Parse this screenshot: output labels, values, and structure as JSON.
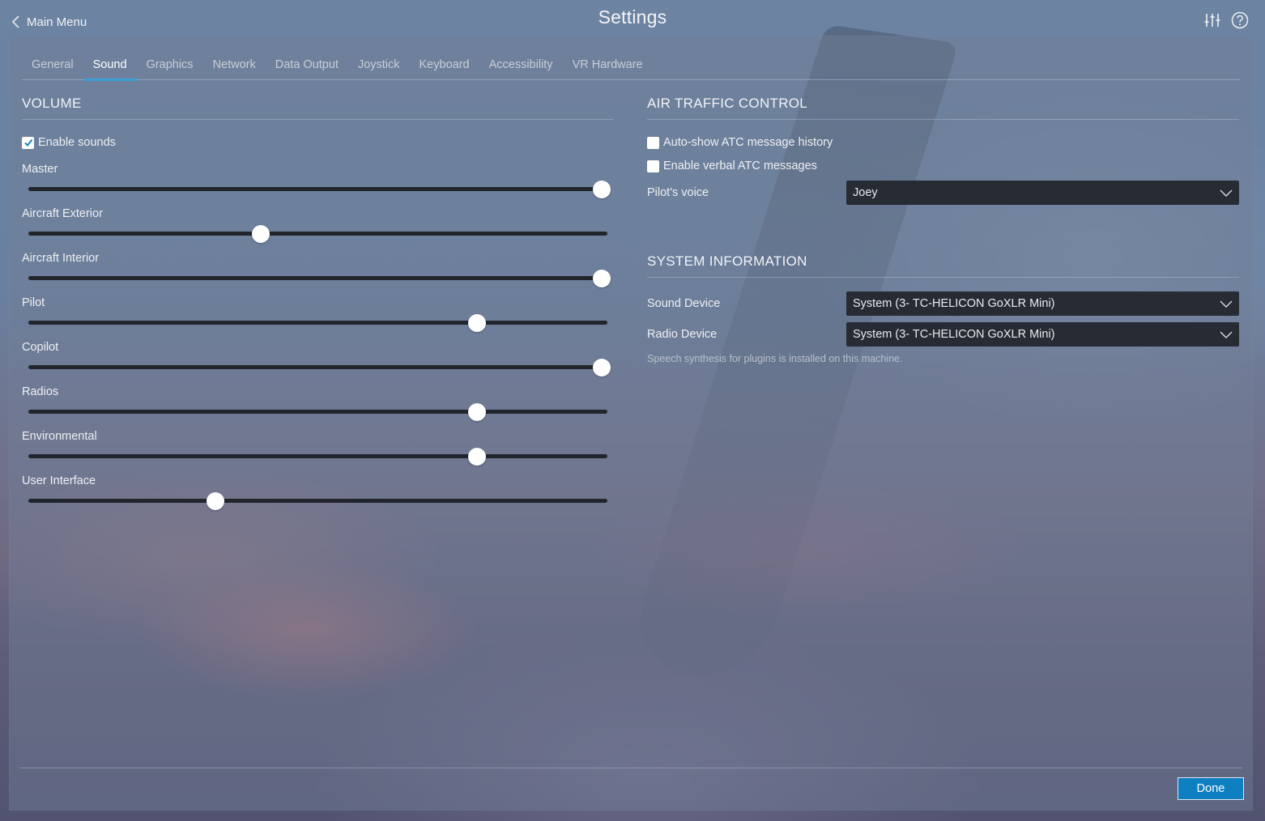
{
  "window": {
    "title": "Settings",
    "back_label": "Main Menu"
  },
  "icons": {
    "back": "chevron-left-icon",
    "adjust": "sliders-icon",
    "help": "help-icon"
  },
  "tabs": [
    {
      "label": "General",
      "active": false
    },
    {
      "label": "Sound",
      "active": true
    },
    {
      "label": "Graphics",
      "active": false
    },
    {
      "label": "Network",
      "active": false
    },
    {
      "label": "Data Output",
      "active": false
    },
    {
      "label": "Joystick",
      "active": false
    },
    {
      "label": "Keyboard",
      "active": false
    },
    {
      "label": "Accessibility",
      "active": false
    },
    {
      "label": "VR Hardware",
      "active": false
    }
  ],
  "volume": {
    "title": "VOLUME",
    "enable_sounds": {
      "label": "Enable sounds",
      "checked": true
    },
    "sliders": [
      {
        "label": "Master",
        "value": 1.0
      },
      {
        "label": "Aircraft Exterior",
        "value": 0.4
      },
      {
        "label": "Aircraft Interior",
        "value": 1.0
      },
      {
        "label": "Pilot",
        "value": 0.78
      },
      {
        "label": "Copilot",
        "value": 1.0
      },
      {
        "label": "Radios",
        "value": 0.78
      },
      {
        "label": "Environmental",
        "value": 0.78
      },
      {
        "label": "User Interface",
        "value": 0.32
      }
    ]
  },
  "atc": {
    "title": "AIR TRAFFIC CONTROL",
    "autoshow": {
      "label": "Auto-show ATC message history",
      "checked": false
    },
    "verbal": {
      "label": "Enable verbal ATC messages",
      "checked": false
    },
    "pilot_voice": {
      "label": "Pilot's voice",
      "value": "Joey"
    }
  },
  "system": {
    "title": "SYSTEM INFORMATION",
    "sound_device": {
      "label": "Sound Device",
      "value": "System (3- TC-HELICON GoXLR Mini)"
    },
    "radio_device": {
      "label": "Radio Device",
      "value": "System (3- TC-HELICON GoXLR Mini)"
    },
    "note": "Speech synthesis for plugins is installed on this machine."
  },
  "footer": {
    "done_label": "Done"
  },
  "colors": {
    "accent": "#3a9fd6",
    "button": "#0e7fc1",
    "dropdown_bg": "#272b33"
  }
}
